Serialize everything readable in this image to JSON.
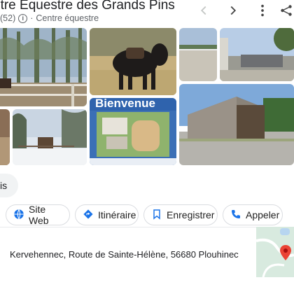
{
  "header": {
    "title": "ntre Équestre des Grands Pins",
    "rating_count": "(52)",
    "separator": "·",
    "category": "Centre équestre"
  },
  "nav": {
    "prev_icon": "chevron-left-icon",
    "next_icon": "chevron-right-icon",
    "more_icon": "more-vert-icon"
  },
  "photos": {
    "sign_text": "Bienvenue"
  },
  "reviews_fragment": "is",
  "actions": [
    {
      "label": "Site Web",
      "icon": "globe-icon"
    },
    {
      "label": "Itinéraire",
      "icon": "directions-icon"
    },
    {
      "label": "Enregistrer",
      "icon": "bookmark-icon"
    },
    {
      "label": "Appeler",
      "icon": "phone-icon"
    }
  ],
  "address": "Kervehennec, Route de Sainte-Hélène, 56680 Plouhinec",
  "colors": {
    "accent": "#1a73e8",
    "pin": "#ea4335"
  }
}
